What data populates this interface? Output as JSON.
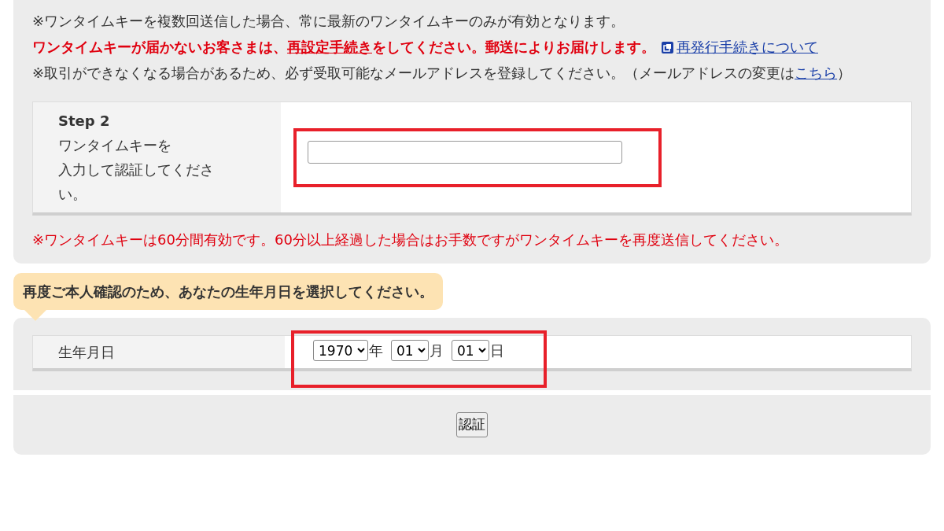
{
  "notice": {
    "line1": "※ワンタイムキーを複数回送信した場合、常に最新のワンタイムキーのみが有効となります。",
    "line2": {
      "before": "ワンタイムキーが届かないお客さまは、",
      "link": "再設定手続き",
      "after": "をしてください。郵送によりお届けします。",
      "extra_link": "再発行手続きについて"
    },
    "line3": {
      "text": "※取引ができなくなる場合があるため、必ず受取可能なメールアドレスを登録してください。（メールアドレスの変更は",
      "link": "こちら",
      "after": "）"
    }
  },
  "step": {
    "title": "Step 2",
    "description": [
      "ワンタイムキーを",
      "入力して認証してください。"
    ]
  },
  "validity_note": "※ワンタイムキーは60分間有効です。60分以上経過した場合はお手数ですがワンタイムキーを再度送信してください。",
  "birth_prompt": "再度ご本人確認のため、あなたの生年月日を選択してください。",
  "birthdate": {
    "label": "生年月日",
    "fields": [
      {
        "value": "1970",
        "unit": "年"
      },
      {
        "value": "01",
        "unit": "月"
      },
      {
        "value": "01",
        "unit": "日"
      }
    ]
  },
  "submit": "認証"
}
